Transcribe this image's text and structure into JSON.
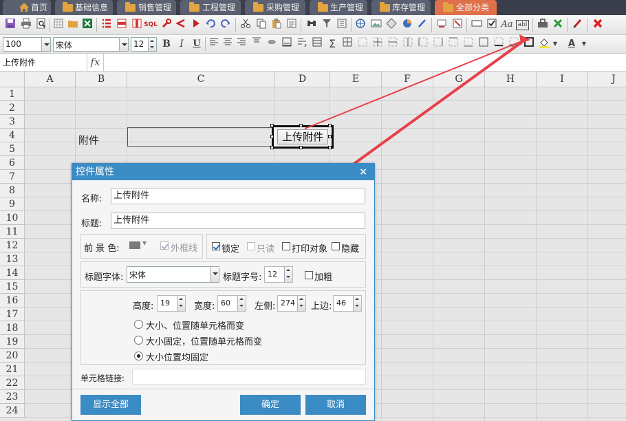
{
  "tabs": [
    {
      "label": "首页",
      "active": false
    },
    {
      "label": "基础信息",
      "active": false
    },
    {
      "label": "销售管理",
      "active": false
    },
    {
      "label": "工程管理",
      "active": false
    },
    {
      "label": "采购管理",
      "active": false
    },
    {
      "label": "生产管理",
      "active": false
    },
    {
      "label": "库存管理",
      "active": false
    },
    {
      "label": "全部分类",
      "active": true
    }
  ],
  "toolbar1": {
    "sql_label": "SQL",
    "text_label": "Aa",
    "field_label": "abl"
  },
  "toolbar2": {
    "zoom": "100",
    "font": "宋体",
    "font_size": "12",
    "bold": "B",
    "italic": "I",
    "underline": "U",
    "sum": "Σ",
    "font_color_letter": "A"
  },
  "formula_bar": {
    "name_box": "上传附件",
    "fx": "fx"
  },
  "sheet": {
    "columns": [
      "A",
      "B",
      "C",
      "D",
      "E",
      "F",
      "G",
      "H",
      "I",
      "J"
    ],
    "rows": [
      "1",
      "2",
      "3",
      "4",
      "5",
      "6",
      "7",
      "8",
      "9",
      "10",
      "11",
      "12",
      "13",
      "14",
      "15",
      "16",
      "17",
      "18",
      "19",
      "20",
      "21",
      "22",
      "23",
      "24"
    ],
    "b4_text": "附件",
    "control_label": "上传附件"
  },
  "dialog": {
    "title": "控件属性",
    "close": "×",
    "name_label": "名称:",
    "name_value": "上传附件",
    "caption_label": "标题:",
    "caption_value": "上传附件",
    "fg_color_label": "前 景 色:",
    "outer_frame_label": "外框线",
    "outer_frame_checked": true,
    "lock_label": "锁定",
    "lock_checked": true,
    "readonly_label": "只读",
    "readonly_checked": false,
    "print_label": "打印对象",
    "print_checked": false,
    "hidden_label": "隐藏",
    "hidden_checked": false,
    "caption_font_label": "标题字体:",
    "caption_font_value": "宋体",
    "caption_size_label": "标题字号:",
    "caption_size_value": "12",
    "bold_label": "加粗",
    "bold_checked": false,
    "height_label": "高度:",
    "height_value": "19",
    "width_label": "宽度:",
    "width_value": "60",
    "left_label": "左侧:",
    "left_value": "274",
    "top_label": "上边:",
    "top_value": "46",
    "radio1": "大小、位置随单元格而变",
    "radio2": "大小固定，位置随单元格而变",
    "radio3": "大小位置均固定",
    "selected_radio": 3,
    "cell_link_label": "单元格链接:",
    "cell_link_value": "",
    "show_all_btn": "显示全部",
    "ok_btn": "确定",
    "cancel_btn": "取消"
  },
  "colors": {
    "tab_bg": "#5b6070",
    "tab_active": "#e0704a",
    "accent": "#3b8bc4",
    "arrow": "#e8404a"
  }
}
